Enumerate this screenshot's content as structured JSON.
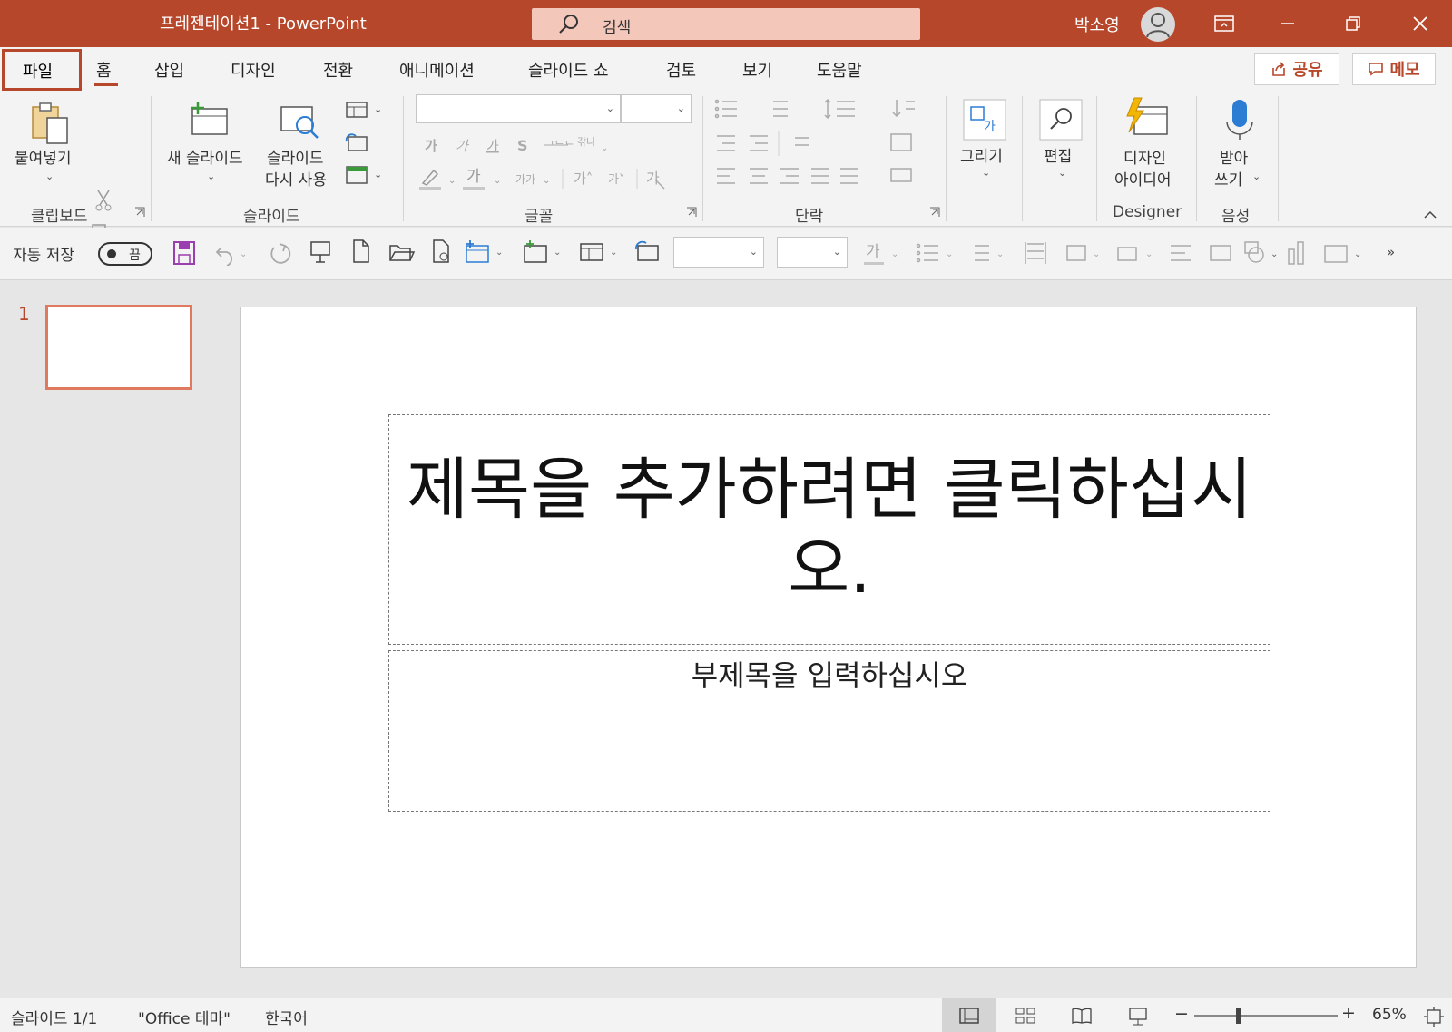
{
  "titlebar": {
    "document_title": "프레젠테이션1  -  PowerPoint",
    "search_placeholder": "검색",
    "user_name": "박소영"
  },
  "tabs": {
    "file": "파일",
    "items": [
      "홈",
      "삽입",
      "디자인",
      "전환",
      "애니메이션",
      "슬라이드 쇼",
      "검토",
      "보기",
      "도움말"
    ],
    "active": "홈",
    "share": "공유",
    "memo": "메모"
  },
  "ribbon": {
    "clipboard": {
      "label": "클립보드",
      "paste": "붙여넣기"
    },
    "slides": {
      "label": "슬라이드",
      "new_slide": "새 슬라이드",
      "reuse_line1": "슬라이드",
      "reuse_line2": "다시 사용"
    },
    "font": {
      "label": "글꼴"
    },
    "paragraph": {
      "label": "단락"
    },
    "drawing": {
      "draw": "그리기"
    },
    "editing": {
      "edit": "편집"
    },
    "designer": {
      "label": "Designer",
      "ideas_line1": "디자인",
      "ideas_line2": "아이디어"
    },
    "voice": {
      "label": "음성",
      "dictate_line1": "받아",
      "dictate_line2": "쓰기"
    }
  },
  "qat": {
    "autosave_label": "자동 저장",
    "autosave_state": "끔"
  },
  "thumbnails": {
    "slide_number": "1"
  },
  "slide": {
    "title_placeholder": "제목을 추가하려면 클릭하십시오.",
    "subtitle_placeholder": "부제목을 입력하십시오"
  },
  "status": {
    "slide_info": "슬라이드 1/1",
    "theme": "\"Office 테마\"",
    "language": "한국어",
    "zoom_minus": "−",
    "zoom_plus": "+",
    "zoom_level": "65%"
  },
  "colors": {
    "accent": "#b7472a",
    "ribbon_bg": "#f3f3f3",
    "workspace_bg": "#e6e6e6"
  }
}
